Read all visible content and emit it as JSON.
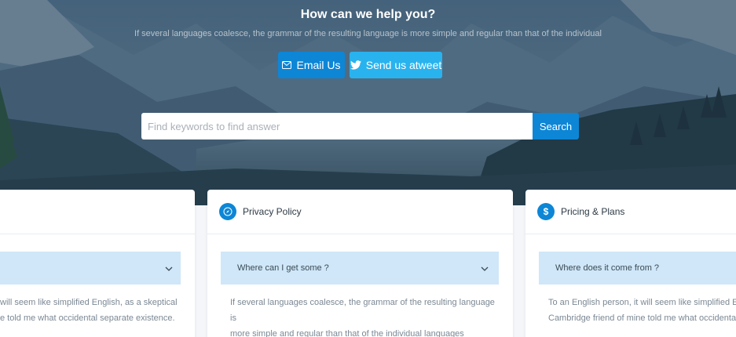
{
  "hero": {
    "title": "How can we help you?",
    "subtitle": "If several languages coalesce, the grammar of the resulting language is more simple and regular than that of the individual",
    "email_label": "Email Us",
    "tweet_label": "Send us atweet"
  },
  "search": {
    "placeholder": "Find keywords to find answer",
    "button_label": "Search"
  },
  "cards": [
    {
      "title": "",
      "question": "",
      "answer_line1": "will seem like simplified English, as a skeptical",
      "answer_line2": "e told me what occidental separate existence."
    },
    {
      "title": "Privacy Policy",
      "question": "Where can I get some ?",
      "answer_line1": "If several languages coalesce, the grammar of the resulting language is",
      "answer_line2": "more simple and regular than that of the individual languages"
    },
    {
      "title": "Pricing & Plans",
      "question": "Where does it come from ?",
      "answer_line1": "To an English person, it will seem like simplified Engli",
      "answer_line2": "Cambridge friend of mine told me what occidental se"
    }
  ],
  "icons": {
    "email": "mail-icon",
    "tweet": "twitter-icon",
    "privacy": "compass-icon",
    "pricing": "dollar-icon",
    "chevron": "chevron-down-icon"
  },
  "colors": {
    "primary": "#0d86d6",
    "twitter": "#29b3ee",
    "faq_bar": "#cfe7f8"
  }
}
